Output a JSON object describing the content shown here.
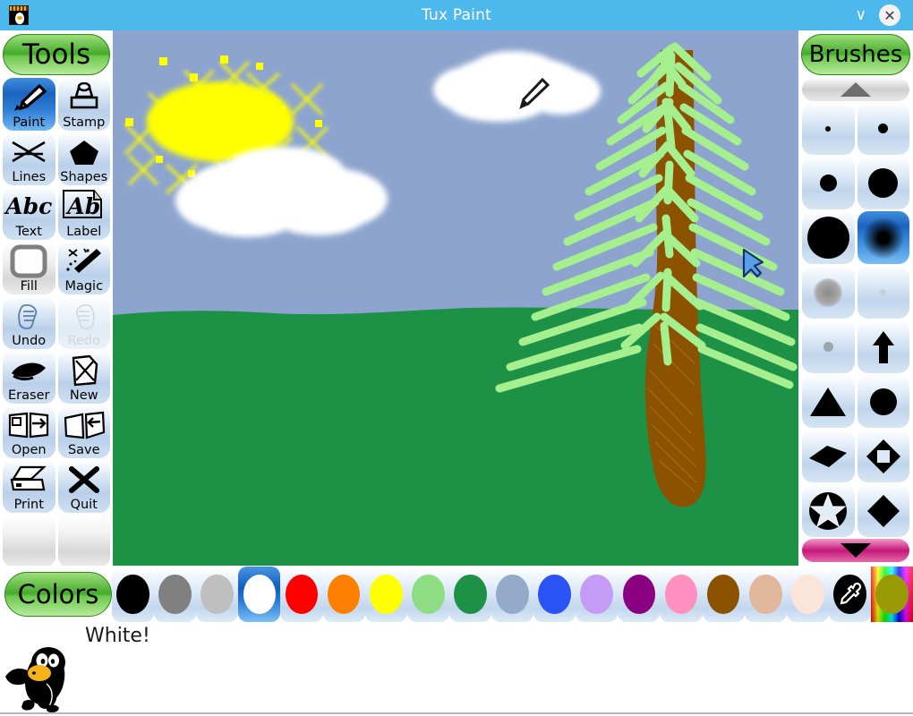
{
  "window": {
    "title": "Tux Paint",
    "app_icon": "tuxpaint-icon",
    "minimize_glyph": "∨",
    "close_glyph": "✕"
  },
  "tools_panel": {
    "header": "Tools",
    "items": [
      {
        "label": "Paint",
        "icon": "paintbrush-icon",
        "state": "selected"
      },
      {
        "label": "Stamp",
        "icon": "stamp-icon",
        "state": "normal"
      },
      {
        "label": "Lines",
        "icon": "lines-icon",
        "state": "normal"
      },
      {
        "label": "Shapes",
        "icon": "pentagon-shape-icon",
        "state": "normal"
      },
      {
        "label": "Text",
        "icon": "abc-text-icon",
        "state": "normal"
      },
      {
        "label": "Label",
        "icon": "abc-label-icon",
        "state": "normal"
      },
      {
        "label": "Fill",
        "icon": "fill-square-icon",
        "state": "greyed"
      },
      {
        "label": "Magic",
        "icon": "magic-wand-icon",
        "state": "normal"
      },
      {
        "label": "Undo",
        "icon": "undo-hand-icon",
        "state": "normal"
      },
      {
        "label": "Redo",
        "icon": "redo-hand-icon",
        "state": "disabled"
      },
      {
        "label": "Eraser",
        "icon": "eraser-icon",
        "state": "normal"
      },
      {
        "label": "New",
        "icon": "new-page-icon",
        "state": "normal"
      },
      {
        "label": "Open",
        "icon": "open-folder-icon",
        "state": "normal"
      },
      {
        "label": "Save",
        "icon": "save-book-icon",
        "state": "normal"
      },
      {
        "label": "Print",
        "icon": "printer-icon",
        "state": "normal"
      },
      {
        "label": "Quit",
        "icon": "quit-x-icon",
        "state": "normal"
      },
      {
        "label": "",
        "icon": "blank-slot-icon",
        "state": "blank"
      },
      {
        "label": "",
        "icon": "blank-slot-icon",
        "state": "blank"
      }
    ]
  },
  "brushes_panel": {
    "header": "Brushes",
    "scroll_up": {
      "icon": "triangle-up-icon",
      "state": "disabled"
    },
    "scroll_down": {
      "icon": "triangle-down-icon",
      "state": "enabled"
    },
    "items": [
      {
        "icon": "brush-dot-tiny",
        "state": "normal"
      },
      {
        "icon": "brush-dot-small",
        "state": "normal"
      },
      {
        "icon": "brush-dot-medium",
        "state": "normal"
      },
      {
        "icon": "brush-dot-large",
        "state": "normal"
      },
      {
        "icon": "brush-dot-xlarge",
        "state": "normal"
      },
      {
        "icon": "brush-soft-round",
        "state": "selected"
      },
      {
        "icon": "brush-fuzzy-grey",
        "state": "normal"
      },
      {
        "icon": "brush-dot-faint",
        "state": "normal"
      },
      {
        "icon": "brush-dot-micro",
        "state": "normal"
      },
      {
        "icon": "brush-arrow-up",
        "state": "normal"
      },
      {
        "icon": "brush-triangle",
        "state": "normal"
      },
      {
        "icon": "brush-circle",
        "state": "normal"
      },
      {
        "icon": "brush-slash-blob",
        "state": "normal"
      },
      {
        "icon": "brush-diamond-hole",
        "state": "normal"
      },
      {
        "icon": "brush-star",
        "state": "normal"
      },
      {
        "icon": "brush-diamond",
        "state": "normal"
      }
    ]
  },
  "colors_panel": {
    "header": "Colors",
    "selected_index": 3,
    "swatches": [
      {
        "name": "black",
        "hex": "#000000"
      },
      {
        "name": "dark-grey",
        "hex": "#808080"
      },
      {
        "name": "light-grey",
        "hex": "#bfbfbf"
      },
      {
        "name": "white",
        "hex": "#ffffff"
      },
      {
        "name": "red",
        "hex": "#ff0000"
      },
      {
        "name": "orange",
        "hex": "#ff7f00"
      },
      {
        "name": "yellow",
        "hex": "#ffff00"
      },
      {
        "name": "light-green",
        "hex": "#8fdd83"
      },
      {
        "name": "dark-green",
        "hex": "#1d9246"
      },
      {
        "name": "steel-blue",
        "hex": "#93aac9"
      },
      {
        "name": "blue",
        "hex": "#2a52f5"
      },
      {
        "name": "lavender",
        "hex": "#c49cf5"
      },
      {
        "name": "purple",
        "hex": "#8b0082"
      },
      {
        "name": "pink",
        "hex": "#ff90c0"
      },
      {
        "name": "brown",
        "hex": "#8b5200"
      },
      {
        "name": "tan",
        "hex": "#e0b79a"
      },
      {
        "name": "cream",
        "hex": "#fae5d8"
      },
      {
        "name": "eyedropper",
        "hex": "#000000"
      },
      {
        "name": "color-picker",
        "hex": "#9a9a06"
      }
    ]
  },
  "status": {
    "message": "White!",
    "mascot": "tux-penguin-mascot"
  },
  "canvas": {
    "sky_color": "#8da5ce",
    "grass_color": "#1d9246",
    "sun_color": "#ffff00",
    "cloud_color": "#ffffff",
    "trunk_color": "#8b5200",
    "foliage_color": "#a5ef8f",
    "cursor_brush": "paintbrush-cursor",
    "cursor_arrow": "arrow-cursor"
  }
}
